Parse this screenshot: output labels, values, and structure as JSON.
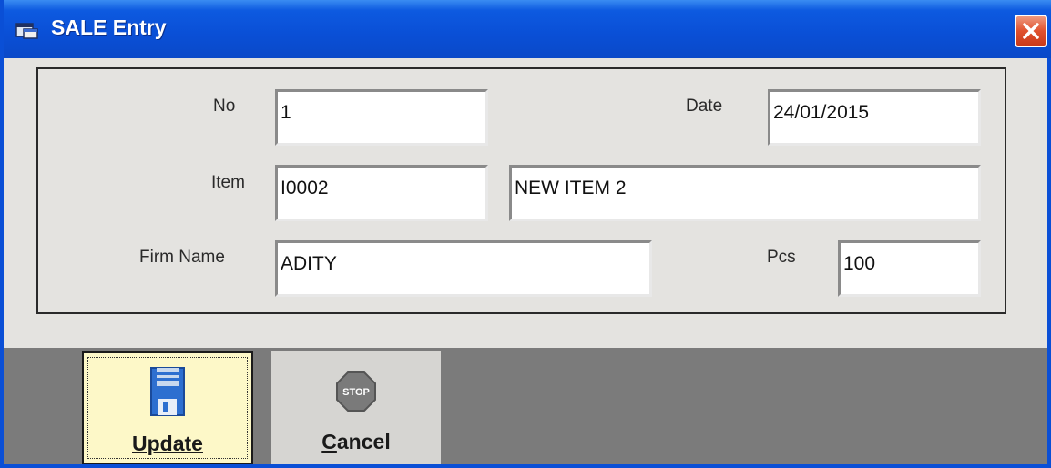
{
  "window": {
    "title": "SALE Entry"
  },
  "form": {
    "no": {
      "label": "No",
      "value": "1"
    },
    "date": {
      "label": "Date",
      "value": "24/01/2015"
    },
    "item": {
      "label": "Item",
      "code": "I0002",
      "name": "NEW ITEM 2"
    },
    "firm": {
      "label": "Firm Name",
      "value": "ADITY"
    },
    "pcs": {
      "label": "Pcs",
      "value": "100"
    }
  },
  "toolbar": {
    "update_label": "Update",
    "cancel_first": "C",
    "cancel_rest": "ancel",
    "update_icon": "floppy-disk-icon",
    "cancel_icon": "stop-sign-icon",
    "stop_text": "STOP"
  },
  "colors": {
    "titlebar": "#0a4fd6",
    "update_bg": "#fdf8c8",
    "toolbar_bg": "#7b7b7b",
    "close_bg": "#e0512e"
  }
}
